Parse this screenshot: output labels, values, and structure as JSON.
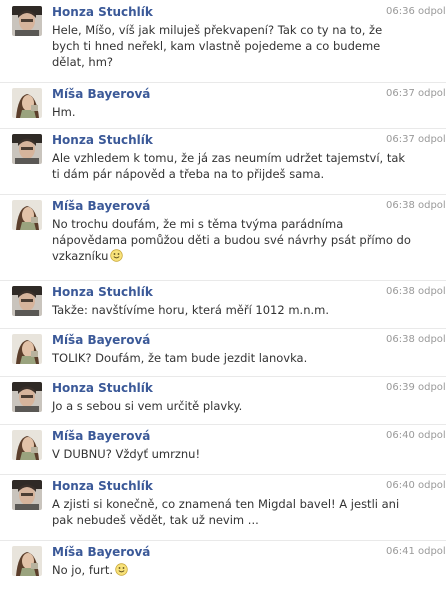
{
  "messages": [
    {
      "sender": "Honza Stuchlík",
      "time": "06:36 odpol.",
      "avatar": "honza-avatar",
      "lines": [
        "Hele, Míšo, víš jak miluješ překvapení? Tak co ty na to, že",
        "bych ti hned neřekl, kam vlastně pojedeme a co budeme",
        "dělat, hm?"
      ],
      "smiley": false
    },
    {
      "sender": "Míša Bayerová",
      "time": "06:37 odpol.",
      "avatar": "misa-avatar",
      "lines": [
        "Hm."
      ],
      "smiley": false
    },
    {
      "sender": "Honza Stuchlík",
      "time": "06:37 odpol.",
      "avatar": "honza-avatar",
      "lines": [
        "Ale vzhledem k tomu, že já zas neumím udržet tajemství, tak",
        "ti dám pár nápověd a třeba na to přijdeš sama."
      ],
      "smiley": false
    },
    {
      "sender": "Míša Bayerová",
      "time": "06:38 odpol.",
      "avatar": "misa-avatar",
      "lines": [
        "No trochu doufám, že mi s těma tvýma parádníma",
        "nápovědama pomůžou děti a budou své návrhy psát přímo do",
        "vzkazníku"
      ],
      "smiley": true
    },
    {
      "sender": "Honza Stuchlík",
      "time": "06:38 odpol.",
      "avatar": "honza-avatar",
      "lines": [
        "Takže: navštívíme horu, která měří 1012 m.n.m."
      ],
      "smiley": false
    },
    {
      "sender": "Míša Bayerová",
      "time": "06:38 odpol.",
      "avatar": "misa-avatar",
      "lines": [
        "TOLIK? Doufám, že tam bude jezdit lanovka."
      ],
      "smiley": false
    },
    {
      "sender": "Honza Stuchlík",
      "time": "06:39 odpol.",
      "avatar": "honza-avatar",
      "lines": [
        "Jo a s sebou si vem určitě plavky."
      ],
      "smiley": false
    },
    {
      "sender": "Míša Bayerová",
      "time": "06:40 odpol.",
      "avatar": "misa-avatar",
      "lines": [
        "V DUBNU? Vždyť umrznu!"
      ],
      "smiley": false
    },
    {
      "sender": "Honza Stuchlík",
      "time": "06:40 odpol.",
      "avatar": "honza-avatar",
      "lines": [
        "A zjisti si konečně, co znamená ten Migdal bavel! A jestli ani",
        "pak nebudeš vědět, tak už nevim ..."
      ],
      "smiley": false
    },
    {
      "sender": "Míša Bayerová",
      "time": "06:41 odpol.",
      "avatar": "misa-avatar",
      "lines": [
        "No jo, furt."
      ],
      "smiley": true
    }
  ],
  "colors": {
    "sender_name": "#3b5998",
    "timestamp": "#999999",
    "body_text": "#333333",
    "divider": "#e9e9e9"
  }
}
